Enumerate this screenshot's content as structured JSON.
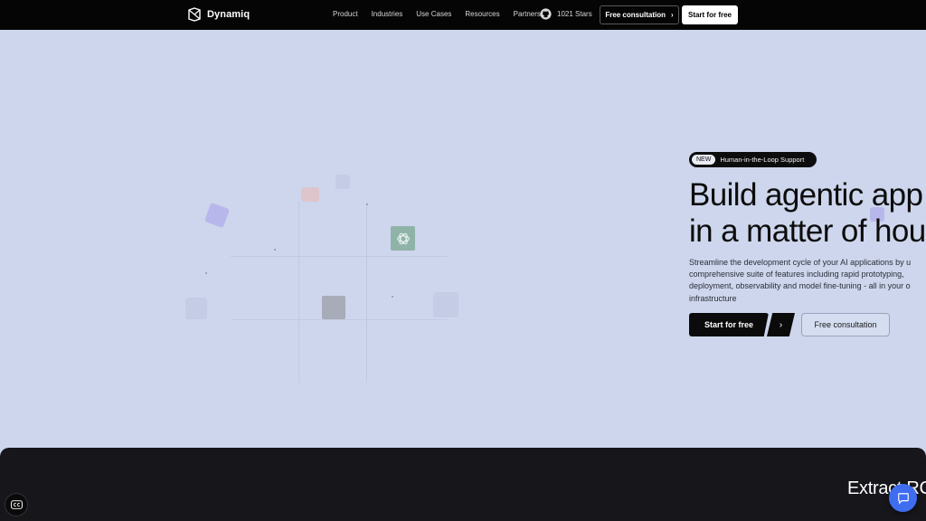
{
  "nav": {
    "brand": "Dynamiq",
    "links": [
      "Product",
      "Industries",
      "Use Cases",
      "Resources",
      "Partners"
    ],
    "github_stars": "1021 Stars",
    "consult_label": "Free consultation",
    "start_label": "Start for free"
  },
  "hero": {
    "badge_new": "NEW",
    "badge_text": "Human-in-the-Loop Support",
    "headline_line1": "Build agentic app",
    "headline_line2": "in a matter of hou",
    "sub_line1": "Streamline the development cycle of your AI applications by u",
    "sub_line2": "comprehensive suite of features including rapid prototyping,",
    "sub_line3": "deployment, observability and model fine-tuning - all in your o",
    "sub_line4": "infrastructure",
    "start_label": "Start for free",
    "arrow": "›",
    "consult_label": "Free consultation"
  },
  "section": {
    "title": "Extract RC"
  },
  "icons": {
    "logo": "dynamiq-cube-icon",
    "github": "github-icon",
    "chevron": "chevron-right-icon",
    "openai": "openai-icon",
    "captions": "closed-captions-icon",
    "chat": "chat-bubble-icon"
  },
  "colors": {
    "nav_bg": "#050505",
    "hero_bg": "#cdd6ec",
    "dark_bg": "#16161b",
    "accent_blue": "#3f6df0"
  }
}
